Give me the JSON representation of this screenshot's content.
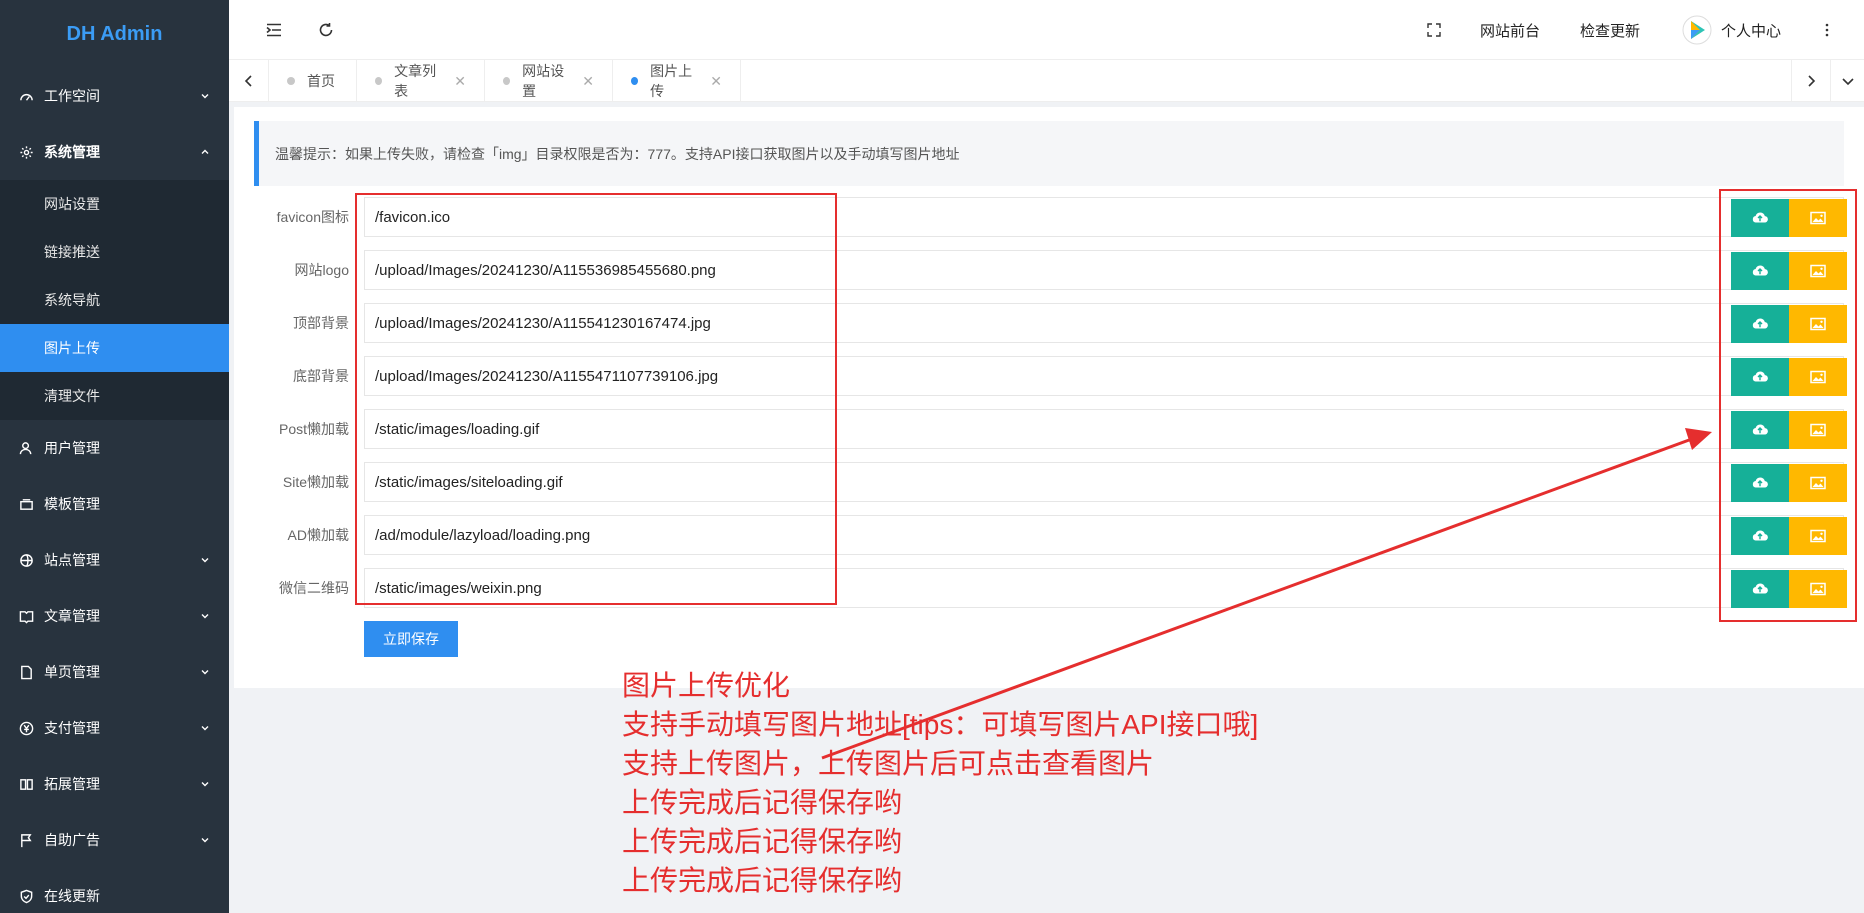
{
  "app": {
    "title": "DH Admin"
  },
  "sidebar": {
    "items": [
      {
        "label": "工作空间",
        "icon": "dashboard-icon",
        "arrow": "down"
      },
      {
        "label": "系统管理",
        "icon": "gear-icon",
        "arrow": "up",
        "children": [
          {
            "label": "网站设置"
          },
          {
            "label": "链接推送"
          },
          {
            "label": "系统导航"
          },
          {
            "label": "图片上传",
            "active": true
          },
          {
            "label": "清理文件"
          }
        ]
      },
      {
        "label": "用户管理",
        "icon": "user-icon"
      },
      {
        "label": "模板管理",
        "icon": "template-icon"
      },
      {
        "label": "站点管理",
        "icon": "site-icon",
        "arrow": "down"
      },
      {
        "label": "文章管理",
        "icon": "book-icon",
        "arrow": "down"
      },
      {
        "label": "单页管理",
        "icon": "page-icon",
        "arrow": "down"
      },
      {
        "label": "支付管理",
        "icon": "yen-icon",
        "arrow": "down"
      },
      {
        "label": "拓展管理",
        "icon": "extension-icon",
        "arrow": "down"
      },
      {
        "label": "自助广告",
        "icon": "flag-icon",
        "arrow": "down"
      },
      {
        "label": "在线更新",
        "icon": "shield-icon"
      }
    ]
  },
  "header": {
    "site_front": "网站前台",
    "check_update": "检查更新",
    "user_center": "个人中心"
  },
  "tabs": [
    {
      "label": "首页",
      "closable": false
    },
    {
      "label": "文章列表",
      "closable": true
    },
    {
      "label": "网站设置",
      "closable": true
    },
    {
      "label": "图片上传",
      "closable": true,
      "active": true
    }
  ],
  "notice": "温馨提示：如果上传失败，请检查「img」目录权限是否为：777。支持API接口获取图片以及手动填写图片地址",
  "fields": [
    {
      "label": "favicon图标",
      "value": "/favicon.ico"
    },
    {
      "label": "网站logo",
      "value": "/upload/Images/20241230/A115536985455680.png"
    },
    {
      "label": "顶部背景",
      "value": "/upload/Images/20241230/A115541230167474.jpg"
    },
    {
      "label": "底部背景",
      "value": "/upload/Images/20241230/A1155471107739106.jpg"
    },
    {
      "label": "Post懒加载",
      "value": "/static/images/loading.gif"
    },
    {
      "label": "Site懒加载",
      "value": "/static/images/siteloading.gif"
    },
    {
      "label": "AD懒加载",
      "value": "/ad/module/lazyload/loading.png"
    },
    {
      "label": "微信二维码",
      "value": "/static/images/weixin.png"
    }
  ],
  "save_label": "立即保存",
  "annotation": {
    "color": "#e52e2e",
    "lines": [
      "图片上传优化",
      "支持手动填写图片地址[tips：可填写图片API接口哦]",
      "支持上传图片，上传图片后可点击查看图片",
      "上传完成后记得保存哟",
      "上传完成后记得保存哟",
      "上传完成后记得保存哟"
    ]
  }
}
